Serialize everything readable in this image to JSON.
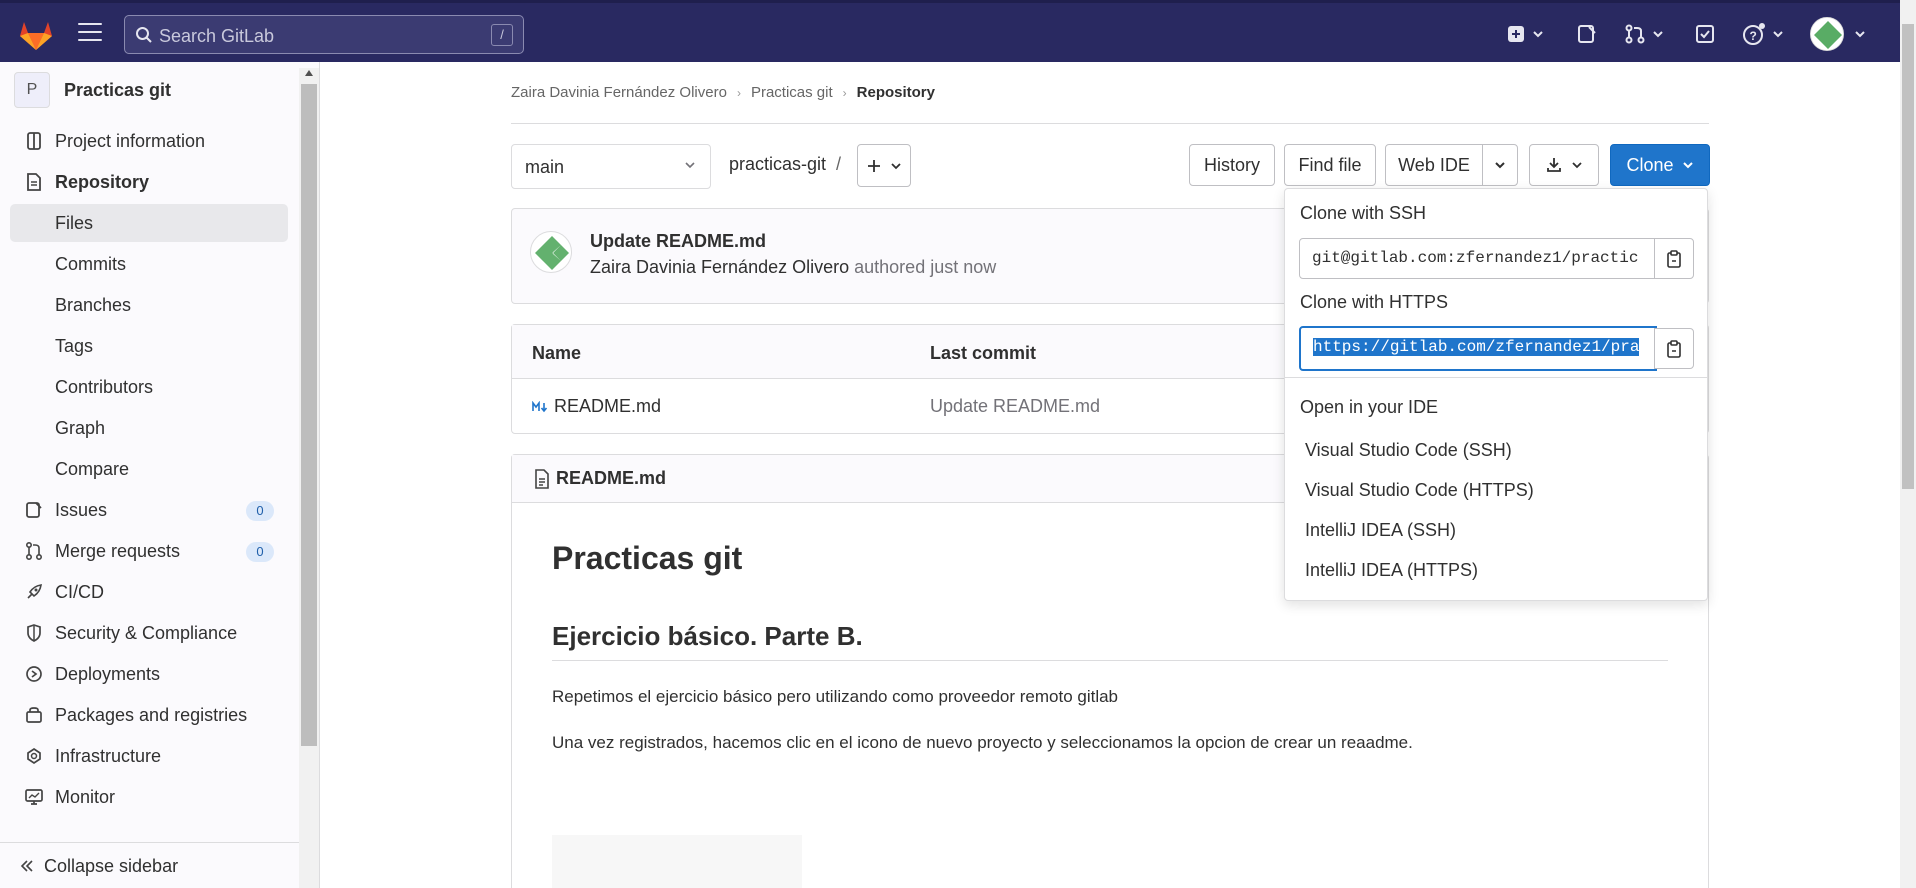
{
  "topbar": {
    "search_placeholder": "Search GitLab",
    "search_shortcut": "/",
    "icons": [
      "gitlab-logo",
      "menu-icon",
      "search-icon",
      "plus-square-icon",
      "issues-icon",
      "merge-request-icon",
      "todo-icon",
      "help-icon",
      "user-avatar"
    ]
  },
  "sidebar": {
    "project_initial": "P",
    "project_name": "Practicas git",
    "items": [
      {
        "label": "Project information"
      },
      {
        "label": "Repository"
      },
      {
        "label": "Files"
      },
      {
        "label": "Commits"
      },
      {
        "label": "Branches"
      },
      {
        "label": "Tags"
      },
      {
        "label": "Contributors"
      },
      {
        "label": "Graph"
      },
      {
        "label": "Compare"
      },
      {
        "label": "Issues",
        "count": "0"
      },
      {
        "label": "Merge requests",
        "count": "0"
      },
      {
        "label": "CI/CD"
      },
      {
        "label": "Security & Compliance"
      },
      {
        "label": "Deployments"
      },
      {
        "label": "Packages and registries"
      },
      {
        "label": "Infrastructure"
      },
      {
        "label": "Monitor"
      }
    ],
    "collapse_label": "Collapse sidebar"
  },
  "breadcrumb": {
    "owner": "Zaira Davinia Fernández Olivero",
    "project": "Practicas git",
    "current": "Repository"
  },
  "toolbar": {
    "branch": "main",
    "path": "practicas-git",
    "path_sep": "/",
    "history": "History",
    "find_file": "Find file",
    "web_ide": "Web IDE",
    "clone": "Clone"
  },
  "commit": {
    "title": "Update README.md",
    "author": "Zaira Davinia Fernández Olivero",
    "meta": "authored just now"
  },
  "tree": {
    "headers": [
      "Name",
      "Last commit"
    ],
    "rows": [
      {
        "name": "README.md",
        "last_commit": "Update README.md"
      }
    ]
  },
  "readme": {
    "filename": "README.md",
    "h1": "Practicas git",
    "h2": "Ejercicio básico. Parte B.",
    "p1": "Repetimos el ejercicio básico pero utilizando como proveedor remoto gitlab",
    "p2": "Una vez registrados, hacemos clic en el icono de nuevo proyecto y seleccionamos la opcion de crear un reaadme."
  },
  "clone_dropdown": {
    "ssh_label": "Clone with SSH",
    "ssh_value": "git@gitlab.com:zfernandez1/practic",
    "https_label": "Clone with HTTPS",
    "https_value": "https://gitlab.com/zfernandez1/pra",
    "ide_label": "Open in your IDE",
    "ide_items": [
      "Visual Studio Code (SSH)",
      "Visual Studio Code (HTTPS)",
      "IntelliJ IDEA (SSH)",
      "IntelliJ IDEA (HTTPS)"
    ]
  },
  "colors": {
    "topbar": "#292961",
    "accent": "#1f75cb",
    "sidebar_bg": "#fbfafd"
  }
}
